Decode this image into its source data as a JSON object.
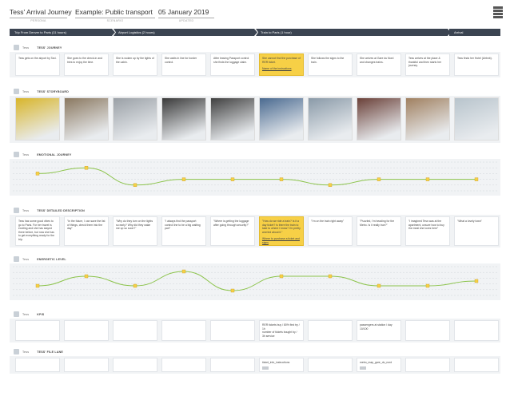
{
  "header": {
    "persona": {
      "value": "Tess' Arrival Journey",
      "label": "PERSONA"
    },
    "scenario": {
      "value": "Example: Public transport",
      "label": "SCENARIO"
    },
    "date": {
      "value": "05 January 2019",
      "label": "UPDATED"
    }
  },
  "phases": [
    {
      "label": "Trip From Denver to Paris (11 hours)"
    },
    {
      "label": "Airport Logistics (2 hours)"
    },
    {
      "label": "Train to Paris (1 hour)"
    },
    {
      "label": "Arrival"
    }
  ],
  "lanes": {
    "journey": {
      "who": "Tess",
      "title": "TESS' JOURNEY"
    },
    "storyboard": {
      "who": "Tess",
      "title": "TESS' STORYBOARD"
    },
    "emotional": {
      "who": "Tess",
      "title": "EMOTIONAL JOURNEY"
    },
    "thoughts": {
      "who": "Tess",
      "title": "TESS' DETAILED DESCRIPTION"
    },
    "energetic": {
      "who": "Tess",
      "title": "ENERGETIC LEVEL"
    },
    "kpis": {
      "who": "Tess",
      "title": "KPIS"
    },
    "files": {
      "who": "Tess",
      "title": "TESS' FILE LANE"
    }
  },
  "journey_cards": [
    {
      "text": "Tess gets on the airport by Taxi."
    },
    {
      "text": "She goes to the check-in and tries to enjoy the time."
    },
    {
      "text": "She is woken up by the lights of the cabin."
    },
    {
      "text": "She waits in line for border control."
    },
    {
      "text": "After leaving Passport control she finds the luggage claim."
    },
    {
      "text": "She cannot find the purchase of RER ticket.",
      "link": "Name of the instructions",
      "highlight": true
    },
    {
      "text": "She follows the signs to the train."
    },
    {
      "text": "She arrives at Gare du Nord and changes trains."
    },
    {
      "text": "Tess arrives at the place & thankful and then starts her journey."
    },
    {
      "text": "Tess finds her Hotel (Airbnb)."
    }
  ],
  "storyboard": [
    {
      "scene": "taxi",
      "color": "#d8b52a"
    },
    {
      "scene": "map",
      "color": "#8a7860"
    },
    {
      "scene": "cabin",
      "color": "#9aa0a6"
    },
    {
      "scene": "queue",
      "color": "#3a3a3a"
    },
    {
      "scene": "luggage",
      "color": "#404040"
    },
    {
      "scene": "station",
      "color": "#4a6a90"
    },
    {
      "scene": "train",
      "color": "#8a9aa8"
    },
    {
      "scene": "platform",
      "color": "#6a4038"
    },
    {
      "scene": "metro",
      "color": "#a08060"
    },
    {
      "scene": "building",
      "color": "#b8c4cc"
    }
  ],
  "emotion": {
    "values": [
      3,
      4,
      1,
      2,
      2,
      2,
      1,
      2,
      2,
      2
    ],
    "range": [
      0,
      5
    ]
  },
  "thought_cards": [
    {
      "text": "Tess has some good vibes to go to Paris. For her travel is exciting and she has stayed there before, but now she has to get everything ready for the trip."
    },
    {
      "text": "\"In the future, I can save the list of things, check them into the day\""
    },
    {
      "text": "\"Why do they turn on the lights so early? Why did they wake me up so soon?\""
    },
    {
      "text": "\"I always find the passport control line to be a big waiting part\""
    },
    {
      "text": "\"Where is getting the luggage after going through security?\""
    },
    {
      "text": "\"How do we ride a train? Is it a day ticket? Is there the train to take to where I know? I'm pretty worried about it.\"",
      "link": "Where to purchase a ticket and signs",
      "highlight": true
    },
    {
      "text": "\"I'm on the train right away\""
    },
    {
      "text": "\"Puzzled, I'm heading for the Metro. Is it really true?\""
    },
    {
      "text": "\"I imagined Tess was at the apartment, unsure how to buy the meal she loves here\""
    },
    {
      "text": "\"What a lovely town\""
    }
  ],
  "energy": {
    "values": [
      2,
      4,
      2,
      5,
      1,
      4,
      4,
      2,
      2,
      3
    ],
    "range": [
      0,
      6
    ]
  },
  "kpi_cards": [
    {
      "text": ""
    },
    {
      "text": ""
    },
    {
      "text": ""
    },
    {
      "text": ""
    },
    {
      "text": ""
    },
    {
      "text": "RER tickets buy / 80% first try / 1h\nnumber of tickets bought by / 3h service"
    },
    {
      "text": ""
    },
    {
      "text": "passengers at station / day 10/100"
    },
    {
      "text": ""
    },
    {
      "text": ""
    }
  ],
  "file_cards": [
    {
      "text": ""
    },
    {
      "text": ""
    },
    {
      "text": ""
    },
    {
      "text": ""
    },
    {
      "text": ""
    },
    {
      "text": "ticket_info_instructions",
      "chip": true
    },
    {
      "text": ""
    },
    {
      "text": "metro_map_gare_du_nord",
      "chip": true
    },
    {
      "text": ""
    },
    {
      "text": ""
    }
  ],
  "colors": {
    "accent": "#f7d046",
    "phase_bar": "#3b4451",
    "lane_bg": "#f1f3f5",
    "curve": "#8bc34a",
    "point": "#f7d046"
  }
}
